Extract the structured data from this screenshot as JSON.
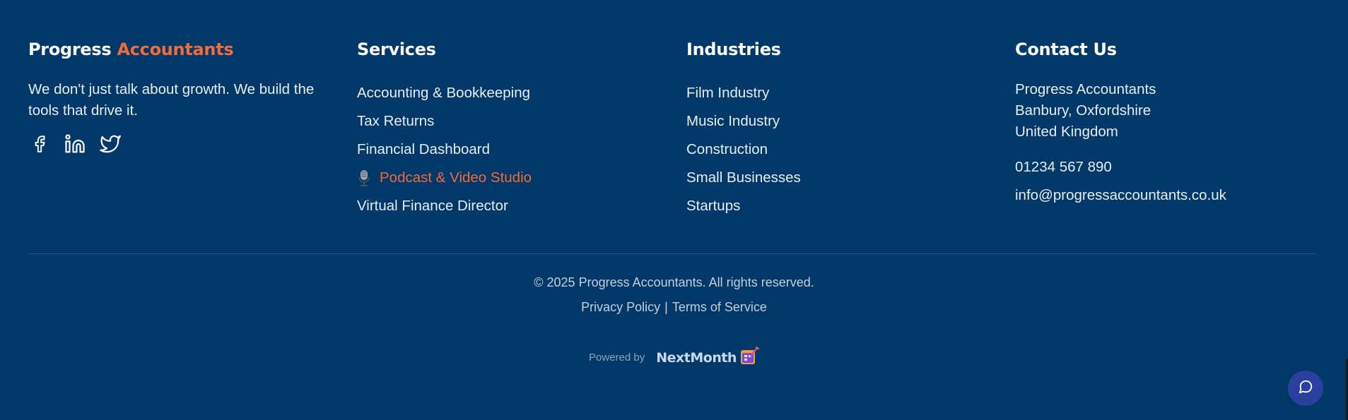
{
  "brand": {
    "name_part1": "Progress",
    "name_part2": "Accountants",
    "tagline": "We don't just talk about growth. We build the tools that drive it.",
    "social_icons": [
      "facebook-icon",
      "linkedin-icon",
      "twitter-icon"
    ]
  },
  "services": {
    "title": "Services",
    "items": [
      {
        "label": "Accounting & Bookkeeping"
      },
      {
        "label": "Tax Returns"
      },
      {
        "label": "Financial Dashboard"
      },
      {
        "label": "Podcast & Video Studio",
        "icon": "microphone-icon",
        "highlight": true
      },
      {
        "label": "Virtual Finance Director"
      }
    ]
  },
  "industries": {
    "title": "Industries",
    "items": [
      {
        "label": "Film Industry"
      },
      {
        "label": "Music Industry"
      },
      {
        "label": "Construction"
      },
      {
        "label": "Small Businesses"
      },
      {
        "label": "Startups"
      }
    ]
  },
  "contact": {
    "title": "Contact Us",
    "address_lines": [
      "Progress Accountants",
      "Banbury, Oxfordshire",
      "United Kingdom"
    ],
    "phone": "01234 567 890",
    "email": "info@progressaccountants.co.uk"
  },
  "bottom": {
    "copyright": "© 2025 Progress Accountants. All rights reserved.",
    "privacy_label": "Privacy Policy",
    "separator": "|",
    "terms_label": "Terms of Service",
    "powered_by_label": "Powered by",
    "powered_by_brand": "NextMonth"
  },
  "chat_button_icon": "chat-bubble-icon",
  "colors": {
    "background": "#003869",
    "accent": "#f26b3a",
    "text": "#e8eef5",
    "muted_text": "#c3cfdc",
    "chat_button": "#2b3f9e"
  }
}
